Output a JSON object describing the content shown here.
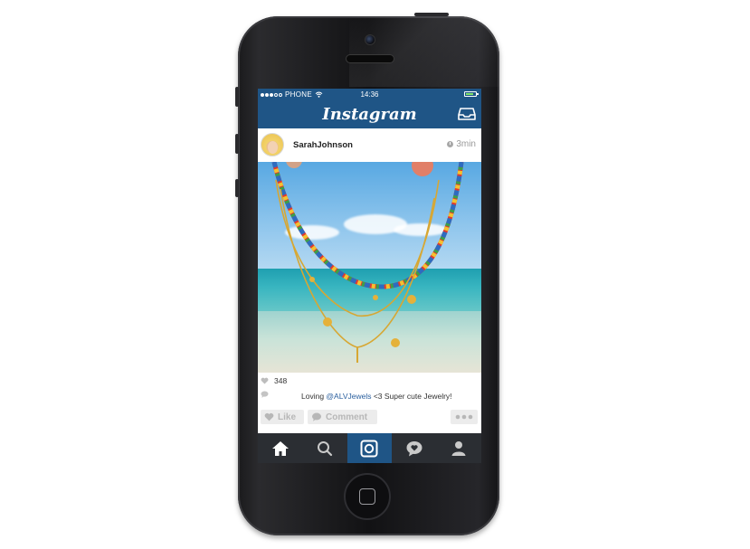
{
  "status_bar": {
    "carrier": "PHONE",
    "time": "14:36",
    "signal_dots_filled": 3,
    "signal_dots_total": 5
  },
  "app": {
    "title": "Instagram",
    "header_color": "#1f5586",
    "tab_bar_color": "#2b2e33"
  },
  "post": {
    "username": "SarahJohnson",
    "time_ago": "3min",
    "likes": "348",
    "caption_prefix": "Loving ",
    "caption_mention": "@ALVJewels",
    "caption_suffix": " <3 Super cute Jewelry!"
  },
  "actions": {
    "like_label": "Like",
    "comment_label": "Comment",
    "more_icon": "ellipsis-icon"
  },
  "tabs": [
    {
      "name": "home",
      "icon": "home-icon",
      "active": false
    },
    {
      "name": "explore",
      "icon": "search-icon",
      "active": false
    },
    {
      "name": "camera",
      "icon": "camera-icon",
      "active": true
    },
    {
      "name": "activity",
      "icon": "heart-bubble-icon",
      "active": false
    },
    {
      "name": "profile",
      "icon": "person-icon",
      "active": false
    }
  ]
}
